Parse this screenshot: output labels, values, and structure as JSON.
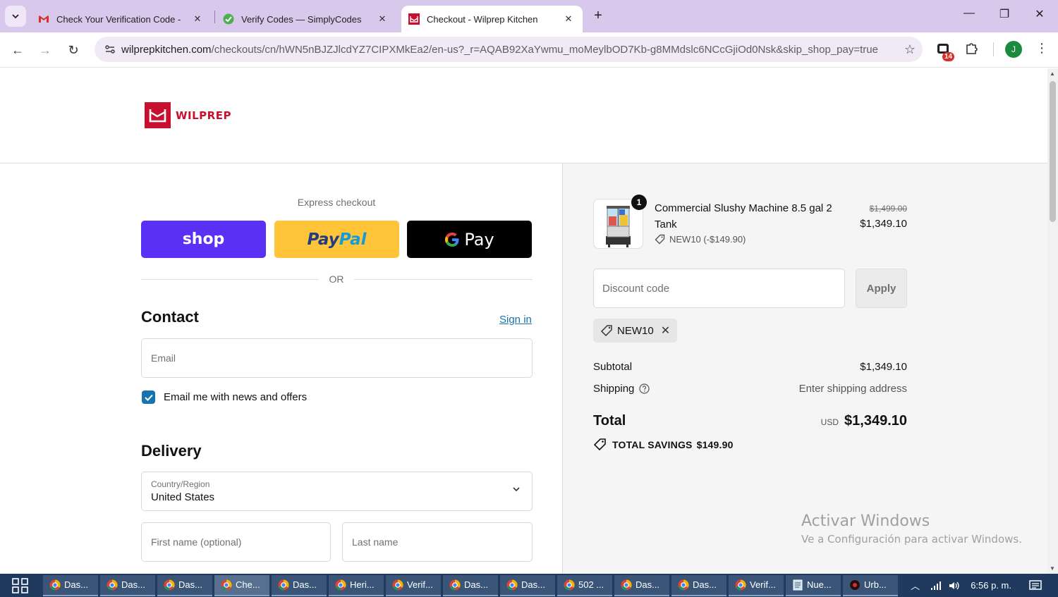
{
  "browser": {
    "tabs": [
      {
        "title": "Check Your Verification Code - ",
        "icon": "gmail-icon"
      },
      {
        "title": "Verify Codes — SimplyCodes",
        "icon": "simplycodes-icon"
      },
      {
        "title": "Checkout - Wilprep Kitchen",
        "icon": "wilprep-icon",
        "active": true
      }
    ],
    "url_host": "wilprepkitchen.com",
    "url_path": "/checkouts/cn/hWN5nBJZJlcdYZ7CIPXMkEa2/en-us?_r=AQAB92XaYwmu_moMeylbOD7Kb-g8MMdslc6NCcGjiOd0Nsk&skip_shop_pay=true",
    "extension_badge": "14",
    "profile_initial": "J"
  },
  "header": {
    "logo_text": "WILPREP"
  },
  "express": {
    "title": "Express checkout",
    "shop_label": "shop",
    "paypal_label_1": "Pay",
    "paypal_label_2": "Pal",
    "gpay_label": "Pay",
    "or_text": "OR"
  },
  "contact": {
    "title": "Contact",
    "signin_label": "Sign in",
    "email_placeholder": "Email",
    "newsletter_label": "Email me with news and offers",
    "newsletter_checked": true
  },
  "delivery": {
    "title": "Delivery",
    "country_label": "Country/Region",
    "country_value": "United States",
    "first_name_placeholder": "First name (optional)",
    "last_name_placeholder": "Last name"
  },
  "summary": {
    "product_name": "Commercial Slushy Machine 8.5 gal 2 Tank",
    "quantity": "1",
    "discount_line": "NEW10 (-$149.90)",
    "price_original": "$1,499.00",
    "price_current": "$1,349.10",
    "discount_placeholder": "Discount code",
    "apply_label": "Apply",
    "applied_code": "NEW10",
    "subtotal_label": "Subtotal",
    "subtotal_value": "$1,349.10",
    "shipping_label": "Shipping",
    "shipping_value": "Enter shipping address",
    "total_label": "Total",
    "total_currency": "USD",
    "total_value": "$1,349.10",
    "savings_label": "TOTAL SAVINGS",
    "savings_value": "$149.90"
  },
  "watermark": {
    "line1": "Activar Windows",
    "line2": "Ve a Configuración para activar Windows."
  },
  "taskbar": {
    "items": [
      "Das...",
      "Das...",
      "Das...",
      "Che...",
      "Das...",
      "Heri...",
      "Verif...",
      "Das...",
      "Das...",
      "502 ...",
      "Das...",
      "Das...",
      "Verif...",
      "Nue...",
      "Urb..."
    ],
    "time": "6:56 p. m."
  },
  "colors": {
    "brand": "#c8102e",
    "shop": "#5a31f4",
    "paypal": "#ffc439",
    "link": "#1773b0"
  }
}
